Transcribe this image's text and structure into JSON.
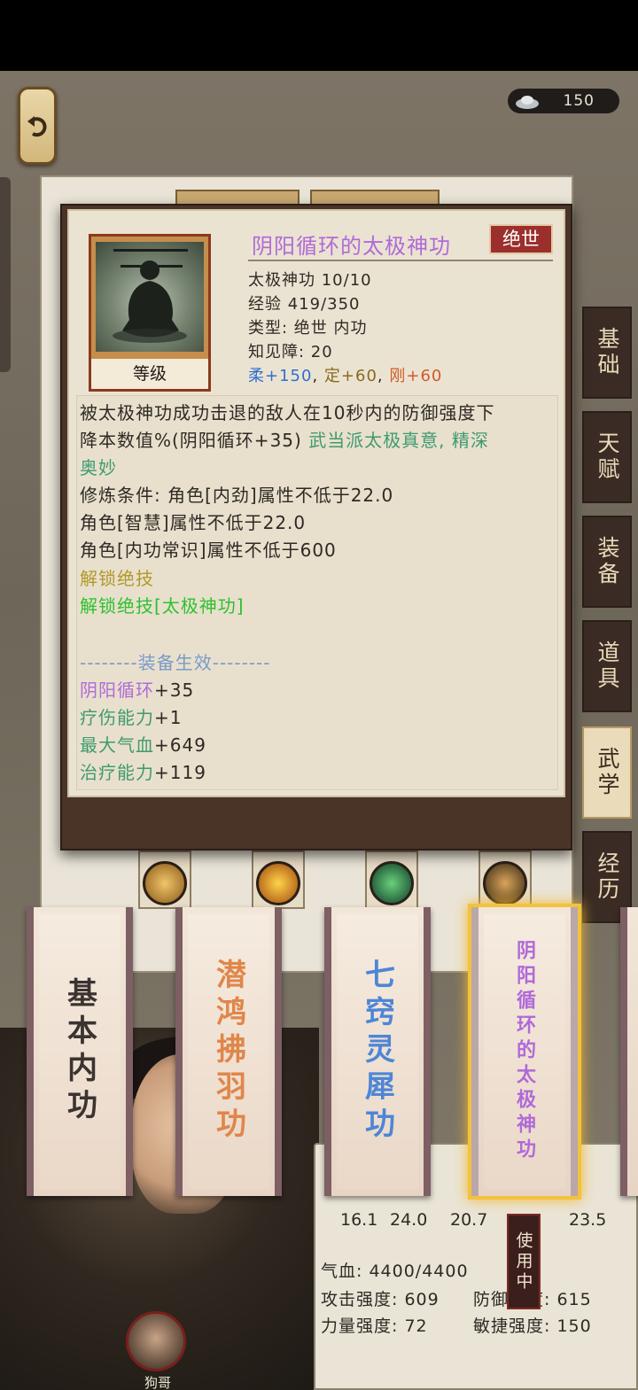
{
  "top": {
    "currency_value": "150"
  },
  "side_tabs": [
    "基础",
    "天赋",
    "装备",
    "道具",
    "武学",
    "经历"
  ],
  "skill_cards": [
    {
      "name": "基本内功",
      "color": "#3b3330"
    },
    {
      "name": "潜鸿拂羽功",
      "color": "#e0864a"
    },
    {
      "name": "七窍灵犀功",
      "color": "#4e86d6"
    },
    {
      "name": "阴阳循环的太极神功",
      "color": "#b06ad8"
    }
  ],
  "in_use_label": "使用中",
  "character": {
    "name": "狗哥"
  },
  "stats": {
    "numbers": [
      "16.1",
      "24.0",
      "20.7",
      "23.5"
    ],
    "qixue": "气血: 4400/4400",
    "attack": "攻击强度: 609",
    "defense": "防御强度: 615",
    "strength": "力量强度: 72",
    "agility": "敏捷强度: 150"
  },
  "popup": {
    "portrait_label": "等级",
    "title": "阴阳循环的太极神功",
    "rarity": "绝世",
    "level_line": "太极神功 10/10",
    "exp_line": "经验 419/350",
    "type_line": "类型: 绝世 内功",
    "barrier_line": "知见障: 20",
    "attr_rou": "柔+150",
    "attr_ding": "定+60",
    "attr_gang": "刚+60",
    "desc1": "被太极神功成功击退的敌人在10秒内的防御强度下",
    "desc2a": "降本数值%(阴阳循环+35)",
    "desc2b": "武当派太极真意, 精深",
    "desc3": "奥妙",
    "req1": "修炼条件: 角色[内劲]属性不低于22.0",
    "req2": "角色[智慧]属性不低于22.0",
    "req3": "角色[内功常识]属性不低于600",
    "unlock1": "解锁绝技",
    "unlock2": "解锁绝技[太极神功]",
    "equip_header": "--------装备生效--------",
    "effects": [
      {
        "label": "阴阳循环",
        "value": "+35",
        "color": "#b06ad8"
      },
      {
        "label": "疗伤能力",
        "value": "+1",
        "color": "#3f9a6f"
      },
      {
        "label": "最大气血",
        "value": "+649",
        "color": "#3f9a6f"
      },
      {
        "label": "治疗能力",
        "value": "+119",
        "color": "#3f9a6f"
      }
    ],
    "colors": {
      "rou": "#2f6fd0",
      "ding": "#8a6a1e",
      "gang": "#d05b28",
      "wudang": "#3f9a6f",
      "unlock_gold": "#b09a2a",
      "unlock_green": "#2fc02f",
      "equip_header": "#7a9ac8"
    }
  }
}
